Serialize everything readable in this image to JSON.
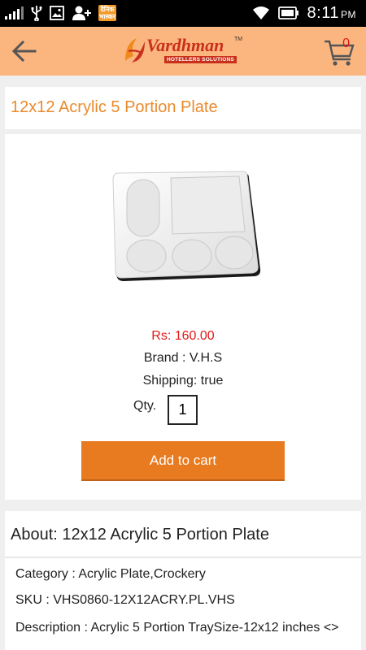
{
  "status_bar": {
    "time": "8:11",
    "ampm": "PM",
    "news_badge": "दैनिक भास्कर"
  },
  "app_bar": {
    "logo_text": "Vardhman",
    "logo_tm": "TM",
    "logo_sub": "HOTELLERS SOLUTIONS",
    "cart_count": "0"
  },
  "product": {
    "title": "12x12 Acrylic 5 Portion Plate",
    "price": "Rs: 160.00",
    "brand": "Brand : V.H.S",
    "shipping": "Shipping: true",
    "qty_label": "Qty.",
    "qty_value": "1",
    "add_to_cart_label": "Add to cart"
  },
  "about": {
    "title": "About: 12x12 Acrylic 5 Portion Plate",
    "category": "Category : Acrylic Plate,Crockery",
    "sku": "SKU : VHS0860-12X12ACRY.PL.VHS",
    "description": "Description : Acrylic 5 Portion TraySize-12x12 inches <>"
  },
  "colors": {
    "app_bar": "#fbb680",
    "accent_orange": "#e87a1f",
    "title_orange": "#e98a2c",
    "price_red": "#e01818"
  },
  "icons": [
    "signal-icon",
    "usb-icon",
    "image-icon",
    "add-contact-icon",
    "wifi-icon",
    "battery-icon",
    "back-arrow-icon",
    "cart-icon"
  ]
}
